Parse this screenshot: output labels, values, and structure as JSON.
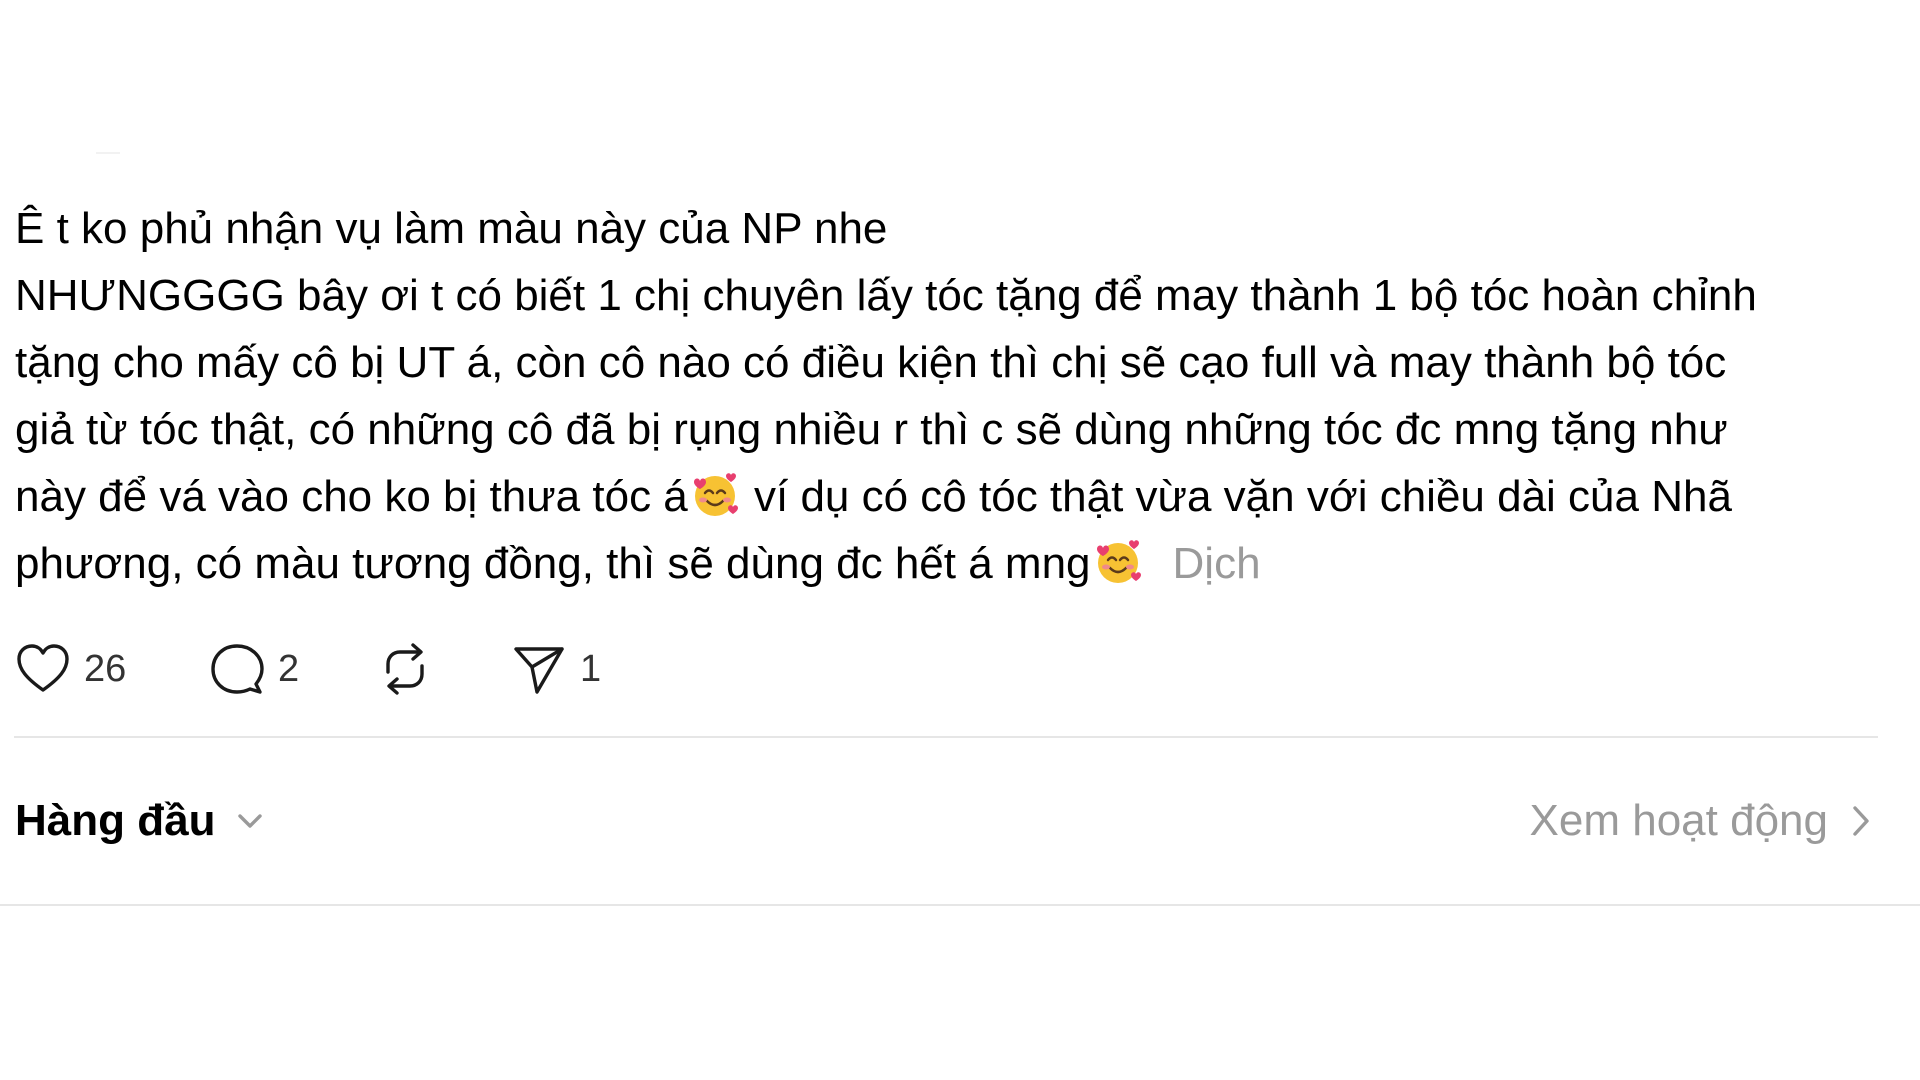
{
  "post": {
    "lines": [
      "Ê t ko phủ nhận vụ làm màu này của NP nhe",
      "NHƯNGGGG bây ơi t có biết 1 chị chuyên lấy tóc tặng để may thành 1 bộ tóc hoàn chỉnh",
      "tặng cho mấy cô bị UT á, còn cô nào có điều kiện thì chị sẽ cạo full và may thành bộ tóc",
      "giả từ tóc thật, có những cô đã bị rụng nhiều r thì c sẽ dùng những tóc đc mng tặng như"
    ],
    "line5_part1": "này để vá vào cho ko bị thưa tóc á",
    "line5_part2": " ví dụ có cô tóc thật vừa vặn với chiều dài của Nhã",
    "line6_part1": "phương, có màu tương đồng, thì sẽ dùng đc hết á mng",
    "translate_label": "Dịch",
    "emoji": "smiling-face-with-hearts-icon"
  },
  "actions": {
    "likes": "26",
    "replies": "2",
    "shares": "1"
  },
  "comments_bar": {
    "sort_label": "Hàng đầu",
    "activity_label": "Xem hoạt động"
  },
  "colors": {
    "text": "#000000",
    "muted": "#9a9a9a",
    "divider": "#e6e6e6",
    "emoji_face": "#f7c233",
    "emoji_heart": "#e83f6f"
  }
}
